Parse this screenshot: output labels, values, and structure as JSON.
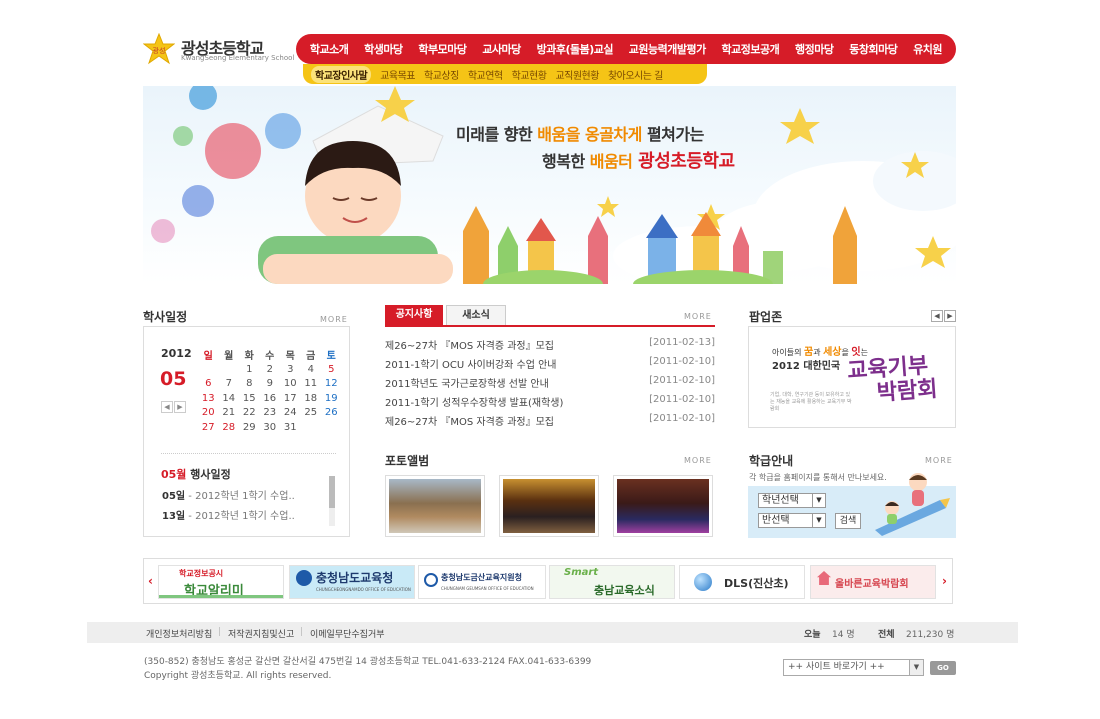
{
  "logo": {
    "name": "광성초등학교",
    "sub": "KwangSeong Elementary School",
    "mark_text": "광성"
  },
  "gnb": [
    "학교소개",
    "학생마당",
    "학부모마당",
    "교사마당",
    "방과후(돌봄)교실",
    "교원능력개발평가",
    "학교정보공개",
    "행정마당",
    "동창회마당",
    "유치원"
  ],
  "lnb": [
    "학교장인사말",
    "교육목표",
    "학교상징",
    "학교연혁",
    "학교현황",
    "교직원현황",
    "찾아오시는 길"
  ],
  "visual": {
    "slogan_line1_a": "미래를 향한 ",
    "slogan_line1_b": "배움을",
    "slogan_line1_c": "  옹골차게",
    "slogan_line1_d": " 펼쳐가는",
    "slogan_line2_a": "행복한 ",
    "slogan_line2_b": "배움터",
    "slogan_line2_c": " 광성초등학교"
  },
  "calendar": {
    "title": "학사일정",
    "more": "MORE",
    "year": "2012",
    "month": "05",
    "weekdays": [
      "일",
      "월",
      "화",
      "수",
      "목",
      "금",
      "토"
    ],
    "weeks": [
      [
        "",
        "",
        "1",
        "2",
        "3",
        "4",
        "5"
      ],
      [
        "6",
        "7",
        "8",
        "9",
        "10",
        "11",
        "12"
      ],
      [
        "13",
        "14",
        "15",
        "16",
        "17",
        "18",
        "19"
      ],
      [
        "20",
        "21",
        "22",
        "23",
        "24",
        "25",
        "26"
      ],
      [
        "27",
        "28",
        "29",
        "30",
        "31",
        "",
        ""
      ]
    ],
    "schedule_title_a": "05월",
    "schedule_title_b": " 행사일정",
    "schedule": [
      {
        "day": "05일",
        "text": " - 2012학년 1학기 수업.."
      },
      {
        "day": "13일",
        "text": " - 2012학년 1학기 수업.."
      }
    ]
  },
  "notice": {
    "tab_active": "공지사항",
    "tab_other": "새소식",
    "more": "MORE",
    "items": [
      {
        "title": "제26~27차 『MOS 자격증 과정』모집",
        "date": "[2011-02-13]"
      },
      {
        "title": "2011-1학기 OCU 사이버강좌 수업 안내",
        "date": "[2011-02-10]"
      },
      {
        "title": "2011학년도 국가근로장학생 선발 안내",
        "date": "[2011-02-10]"
      },
      {
        "title": "2011-1학기 성적우수장학생 발표(재학생)",
        "date": "[2011-02-10]"
      },
      {
        "title": "제26~27차 『MOS 자격증 과정』모집",
        "date": "[2011-02-10]"
      }
    ]
  },
  "photo": {
    "title": "포토앨범",
    "more": "MORE"
  },
  "popup": {
    "title": "팝업존",
    "line1_a": "아이들의 ",
    "line1_b": "꿈",
    "line1_c": "과 ",
    "line1_d": "세상",
    "line1_e": "을 ",
    "line1_f": "잇",
    "line1_g": "는",
    "line2": "2012 대한민국",
    "callig1": "교육기부",
    "callig2": "박람회",
    "note": "기업, 대학, 연구기관 등이 보유하고 있는 재능을 교육에 활용하는 교육기부 박람회"
  },
  "grade": {
    "title": "학급안내",
    "more": "MORE",
    "desc": "각 학급을 홈페이지를 통해서 만나보세요.",
    "select_grade": "학년선택",
    "select_class": "반선택",
    "search": "검색"
  },
  "banners": [
    {
      "label": "학교정보공시",
      "sub": "학교알리미"
    },
    {
      "label": "충청남도교육청",
      "sub": "CHUNGCHEONGNAMDO OFFICE OF EDUCATION"
    },
    {
      "label": "충청남도금산교육지원청",
      "sub": "CHUNGNAM GEUMSAN OFFICE OF EDUCATION"
    },
    {
      "label": "충남교육소식",
      "sub": "Smart"
    },
    {
      "label": "DLS(진산초)"
    },
    {
      "label": "올바른교육박람회"
    }
  ],
  "footer": {
    "links": [
      "개인정보처리방침",
      "저작권지침및신고",
      "이메일무단수집거부"
    ],
    "today_label": "오늘",
    "today_value": "14 명",
    "total_label": "전체",
    "total_value": "211,230 명",
    "address": "(350-852) 충청남도 홍성군 갈산면 갈산서길 475번길 14 광성초등학교  TEL.041-633-2124 FAX.041-633-6399",
    "copyright": "Copyright 광성초등학교. All rights reserved.",
    "site_select": "++ 사이트 바로가기 ++",
    "go": "GO"
  },
  "colors": {
    "accent_red": "#d61c28",
    "accent_yellow": "#f5c416",
    "sky": "#d8ecf8"
  }
}
